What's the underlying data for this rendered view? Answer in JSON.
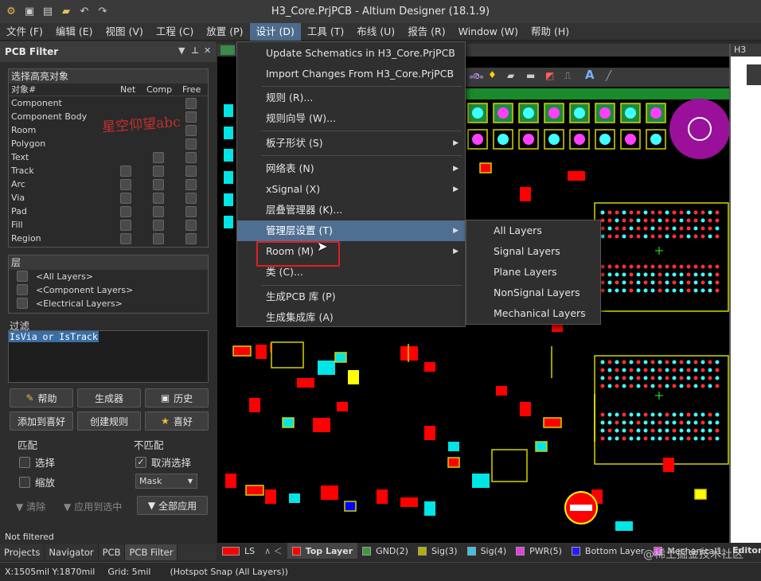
{
  "window": {
    "title": "H3_Core.PrjPCB - Altium Designer (18.1.9)"
  },
  "menubar": [
    "文件 (F)",
    "编辑 (E)",
    "视图 (V)",
    "工程 (C)",
    "放置 (P)",
    "设计 (D)",
    "工具 (T)",
    "布线 (U)",
    "报告 (R)",
    "Window (W)",
    "帮助 (H)"
  ],
  "panel": {
    "title": "PCB Filter",
    "highlight_group": "选择高亮对象",
    "col_object": "对象#",
    "col_net": "Net",
    "col_comp": "Comp",
    "col_free": "Free",
    "objects": [
      "Component",
      "Component Body",
      "Room",
      "Polygon",
      "Text",
      "Track",
      "Arc",
      "Via",
      "Pad",
      "Fill",
      "Region"
    ],
    "layer_group": "层",
    "layers": [
      "<All Layers>",
      "<Component Layers>",
      "<Electrical Layers>"
    ],
    "filter_label": "过滤",
    "filter_query": "IsVia or IsTrack",
    "buttons": {
      "help": "帮助",
      "builder": "生成器",
      "history": "历史",
      "add_fav": "添加到喜好",
      "create_rule": "创建规则",
      "favorites": "喜好"
    },
    "match": "匹配",
    "nomatch": "不匹配",
    "select": "选择",
    "zoom": "缩放",
    "deselect": "取消选择",
    "mask": "Mask",
    "clear": "清除",
    "apply_selected": "应用到选中",
    "apply_all": "全部应用",
    "status": "Not filtered"
  },
  "panel_tabs": [
    "Projects",
    "Navigator",
    "PCB",
    "PCB Filter"
  ],
  "dropdown": {
    "items": [
      "Update Schematics in H3_Core.PrjPCB",
      "Import Changes From H3_Core.PrjPCB",
      "规则 (R)...",
      "规则向导 (W)...",
      "板子形状 (S)",
      "网络表 (N)",
      "xSignal (X)",
      "层叠管理器 (K)...",
      "管理层设置 (T)",
      "Room (M)",
      "类 (C)...",
      "生成PCB 库 (P)",
      "生成集成库 (A)"
    ]
  },
  "submenu": [
    "All Layers",
    "Signal Layers",
    "Plane Layers",
    "NonSignal Layers",
    "Mechanical Layers"
  ],
  "layer_tabs": [
    {
      "name": "LS",
      "color": "#ff0000"
    },
    {
      "name": "Top Layer",
      "color": "#ff0000"
    },
    {
      "name": "GND(2)",
      "color": "#3c9a3c"
    },
    {
      "name": "Sig(3)",
      "color": "#b0b000"
    },
    {
      "name": "Sig(4)",
      "color": "#40c0e0"
    },
    {
      "name": "PWR(5)",
      "color": "#e040e0"
    },
    {
      "name": "Bottom Layer",
      "color": "#2020ff"
    },
    {
      "name": "Mechanical1",
      "color": "#e040e0"
    }
  ],
  "editor_tab": "Editor",
  "schem_tab": "H3",
  "status": {
    "coords": "X:1505mil Y:1870mil",
    "grid": "Grid: 5mil",
    "snap": "(Hotspot Snap (All Layers))"
  },
  "watermark": "星空仰望abc",
  "site_watermark": "@稀土掘金技术社区"
}
